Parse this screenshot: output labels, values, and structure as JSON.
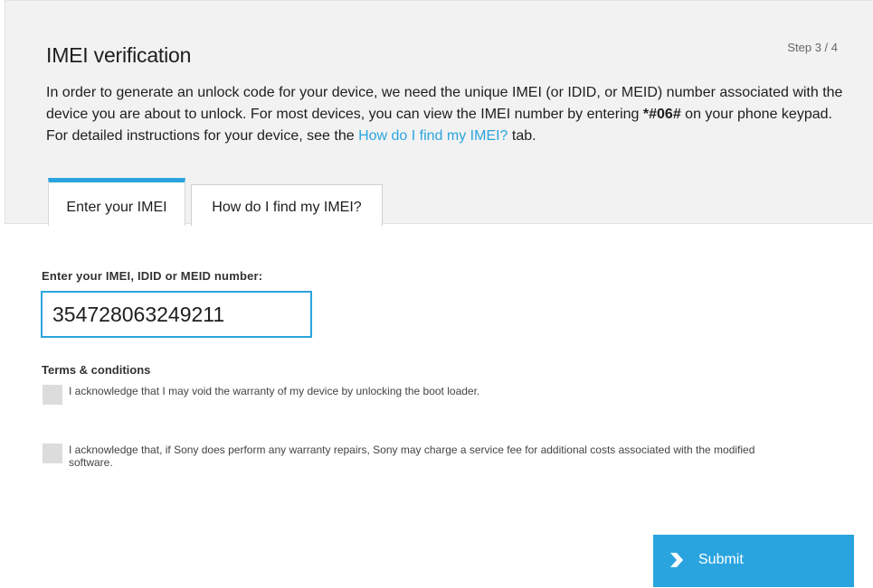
{
  "page": {
    "title": "IMEI verification",
    "step": "Step 3 / 4",
    "intro": {
      "text1": "In order to generate an unlock code for your device, we need the unique IMEI (or IDID, or MEID) number associated with the device you are about to unlock. For most devices, you can view the IMEI number by entering ",
      "code": "*#06#",
      "text2": " on your phone keypad. For detailed instructions for your device, see the ",
      "link": "How do I find my IMEI?",
      "text3": " tab."
    }
  },
  "tabs": [
    {
      "label": "Enter your IMEI",
      "active": true
    },
    {
      "label": "How do I find my IMEI?",
      "active": false
    }
  ],
  "form": {
    "imei_label": "Enter your IMEI, IDID or MEID number:",
    "imei_value": "354728063249211",
    "terms_title": "Terms & conditions",
    "terms": [
      {
        "text": "I acknowledge that I may void the warranty of my device by unlocking the boot loader.",
        "checked": false
      },
      {
        "text": "I acknowledge that, if Sony does perform any warranty repairs, Sony may charge a service fee for additional costs associated with the modified software.",
        "checked": false
      }
    ],
    "submit_label": "Submit"
  },
  "colors": {
    "accent": "#2aa4df",
    "panel_bg": "#f2f2f2",
    "checkbox_bg": "#dcdcdc"
  }
}
